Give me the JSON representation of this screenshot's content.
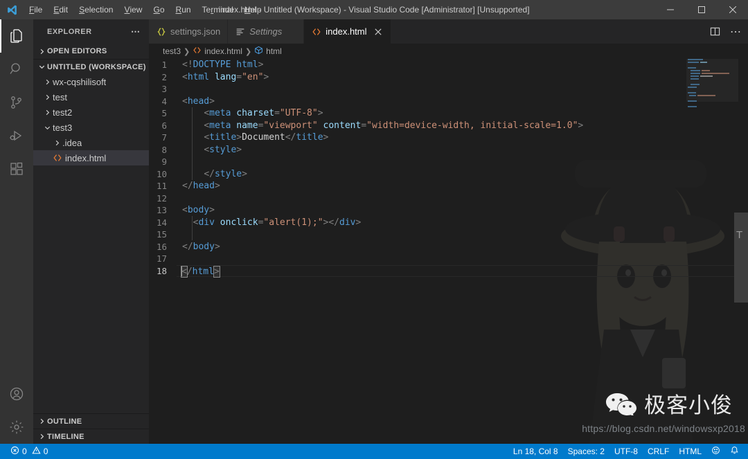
{
  "titlebar": {
    "title": "index.html - Untitled (Workspace) - Visual Studio Code [Administrator] [Unsupported]",
    "logo_icon": "vscode-logo",
    "menu": [
      {
        "label": "File",
        "mnemonic": "F"
      },
      {
        "label": "Edit",
        "mnemonic": "E"
      },
      {
        "label": "Selection",
        "mnemonic": "S"
      },
      {
        "label": "View",
        "mnemonic": "V"
      },
      {
        "label": "Go",
        "mnemonic": "G"
      },
      {
        "label": "Run",
        "mnemonic": "R"
      },
      {
        "label": "Terminal",
        "mnemonic": "T"
      },
      {
        "label": "Help",
        "mnemonic": "H"
      }
    ],
    "window_controls": [
      {
        "name": "minimize-button",
        "icon": "minimize-icon"
      },
      {
        "name": "maximize-button",
        "icon": "maximize-icon"
      },
      {
        "name": "close-button",
        "icon": "close-icon"
      }
    ]
  },
  "activitybar": {
    "items": [
      {
        "name": "explorer",
        "icon": "files-icon",
        "active": true
      },
      {
        "name": "search",
        "icon": "search-icon",
        "active": false
      },
      {
        "name": "source-control",
        "icon": "branch-icon",
        "active": false
      },
      {
        "name": "run-debug",
        "icon": "run-debug-icon",
        "active": false
      },
      {
        "name": "extensions",
        "icon": "extensions-icon",
        "active": false
      }
    ],
    "bottom": [
      {
        "name": "accounts",
        "icon": "account-icon"
      },
      {
        "name": "settings",
        "icon": "gear-icon"
      }
    ]
  },
  "sidebar": {
    "header": "EXPLORER",
    "more_icon": "ellipsis-icon",
    "sections": {
      "open_editors": "OPEN EDITORS",
      "workspace": "UNTITLED (WORKSPACE)",
      "outline": "OUTLINE",
      "timeline": "TIMELINE"
    },
    "tree": [
      {
        "label": "wx-cqshilisoft",
        "type": "folder",
        "expanded": false,
        "depth": 1,
        "selected": false
      },
      {
        "label": "test",
        "type": "folder",
        "expanded": false,
        "depth": 1,
        "selected": false
      },
      {
        "label": "test2",
        "type": "folder",
        "expanded": false,
        "depth": 1,
        "selected": false
      },
      {
        "label": "test3",
        "type": "folder",
        "expanded": true,
        "depth": 1,
        "selected": false
      },
      {
        "label": ".idea",
        "type": "folder",
        "expanded": false,
        "depth": 2,
        "selected": false
      },
      {
        "label": "index.html",
        "type": "html",
        "expanded": false,
        "depth": 2,
        "selected": true
      }
    ]
  },
  "tabs": [
    {
      "label": "settings.json",
      "icon": "json-icon",
      "active": false,
      "preview": false,
      "dirty": false
    },
    {
      "label": "Settings",
      "icon": "settings-editor-icon",
      "active": false,
      "preview": true,
      "dirty": false
    },
    {
      "label": "index.html",
      "icon": "html-icon",
      "active": true,
      "preview": false,
      "dirty": false
    }
  ],
  "tabbar_actions": [
    {
      "name": "split-editor-button",
      "icon": "split-editor-icon"
    },
    {
      "name": "more-actions-button",
      "icon": "ellipsis-icon"
    }
  ],
  "breadcrumb": [
    {
      "label": "test3",
      "icon": ""
    },
    {
      "label": "index.html",
      "icon": "html-icon"
    },
    {
      "label": "html",
      "icon": "symbol-field-icon"
    }
  ],
  "editor": {
    "language": "HTML",
    "cursor": {
      "line": 18,
      "column": 8
    },
    "lines": [
      {
        "n": 1,
        "text": "<!DOCTYPE html>"
      },
      {
        "n": 2,
        "text": "<html lang=\"en\">"
      },
      {
        "n": 3,
        "text": ""
      },
      {
        "n": 4,
        "text": "<head>"
      },
      {
        "n": 5,
        "text": "    <meta charset=\"UTF-8\">"
      },
      {
        "n": 6,
        "text": "    <meta name=\"viewport\" content=\"width=device-width, initial-scale=1.0\">"
      },
      {
        "n": 7,
        "text": "    <title>Document</title>"
      },
      {
        "n": 8,
        "text": "    <style>"
      },
      {
        "n": 9,
        "text": ""
      },
      {
        "n": 10,
        "text": "    </style>"
      },
      {
        "n": 11,
        "text": "</head>"
      },
      {
        "n": 12,
        "text": ""
      },
      {
        "n": 13,
        "text": "<body>"
      },
      {
        "n": 14,
        "text": "  <div onclick=\"alert(1);\"></div>"
      },
      {
        "n": 15,
        "text": ""
      },
      {
        "n": 16,
        "text": "</body>"
      },
      {
        "n": 17,
        "text": ""
      },
      {
        "n": 18,
        "text": "</html>"
      }
    ]
  },
  "statusbar": {
    "errors": "0",
    "warnings": "0",
    "error_icon": "error-circle-icon",
    "warning_icon": "warning-triangle-icon",
    "position": "Ln 18, Col 8",
    "indentation": "Spaces: 2",
    "encoding": "UTF-8",
    "eol": "CRLF",
    "language": "HTML",
    "feedback_icon": "smiley-icon",
    "bell_icon": "bell-icon"
  },
  "watermarks": {
    "wechat_name": "极客小俊",
    "wechat_icon": "wechat-icon",
    "url": "https://blog.csdn.net/windowsxp2018"
  },
  "colors": {
    "accent": "#007acc",
    "titlebar_bg": "#3c3c3c",
    "activitybar_bg": "#333333",
    "sidebar_bg": "#252526",
    "editor_bg": "#1e1e1e",
    "tab_active_bg": "#1e1e1e",
    "tab_inactive_bg": "#2d2d2d",
    "html_icon": "#e37933",
    "json_icon": "#cbcb41",
    "tag": "#569cd6",
    "attribute": "#9cdcfe",
    "string": "#ce9178",
    "text": "#d4d4d4"
  }
}
